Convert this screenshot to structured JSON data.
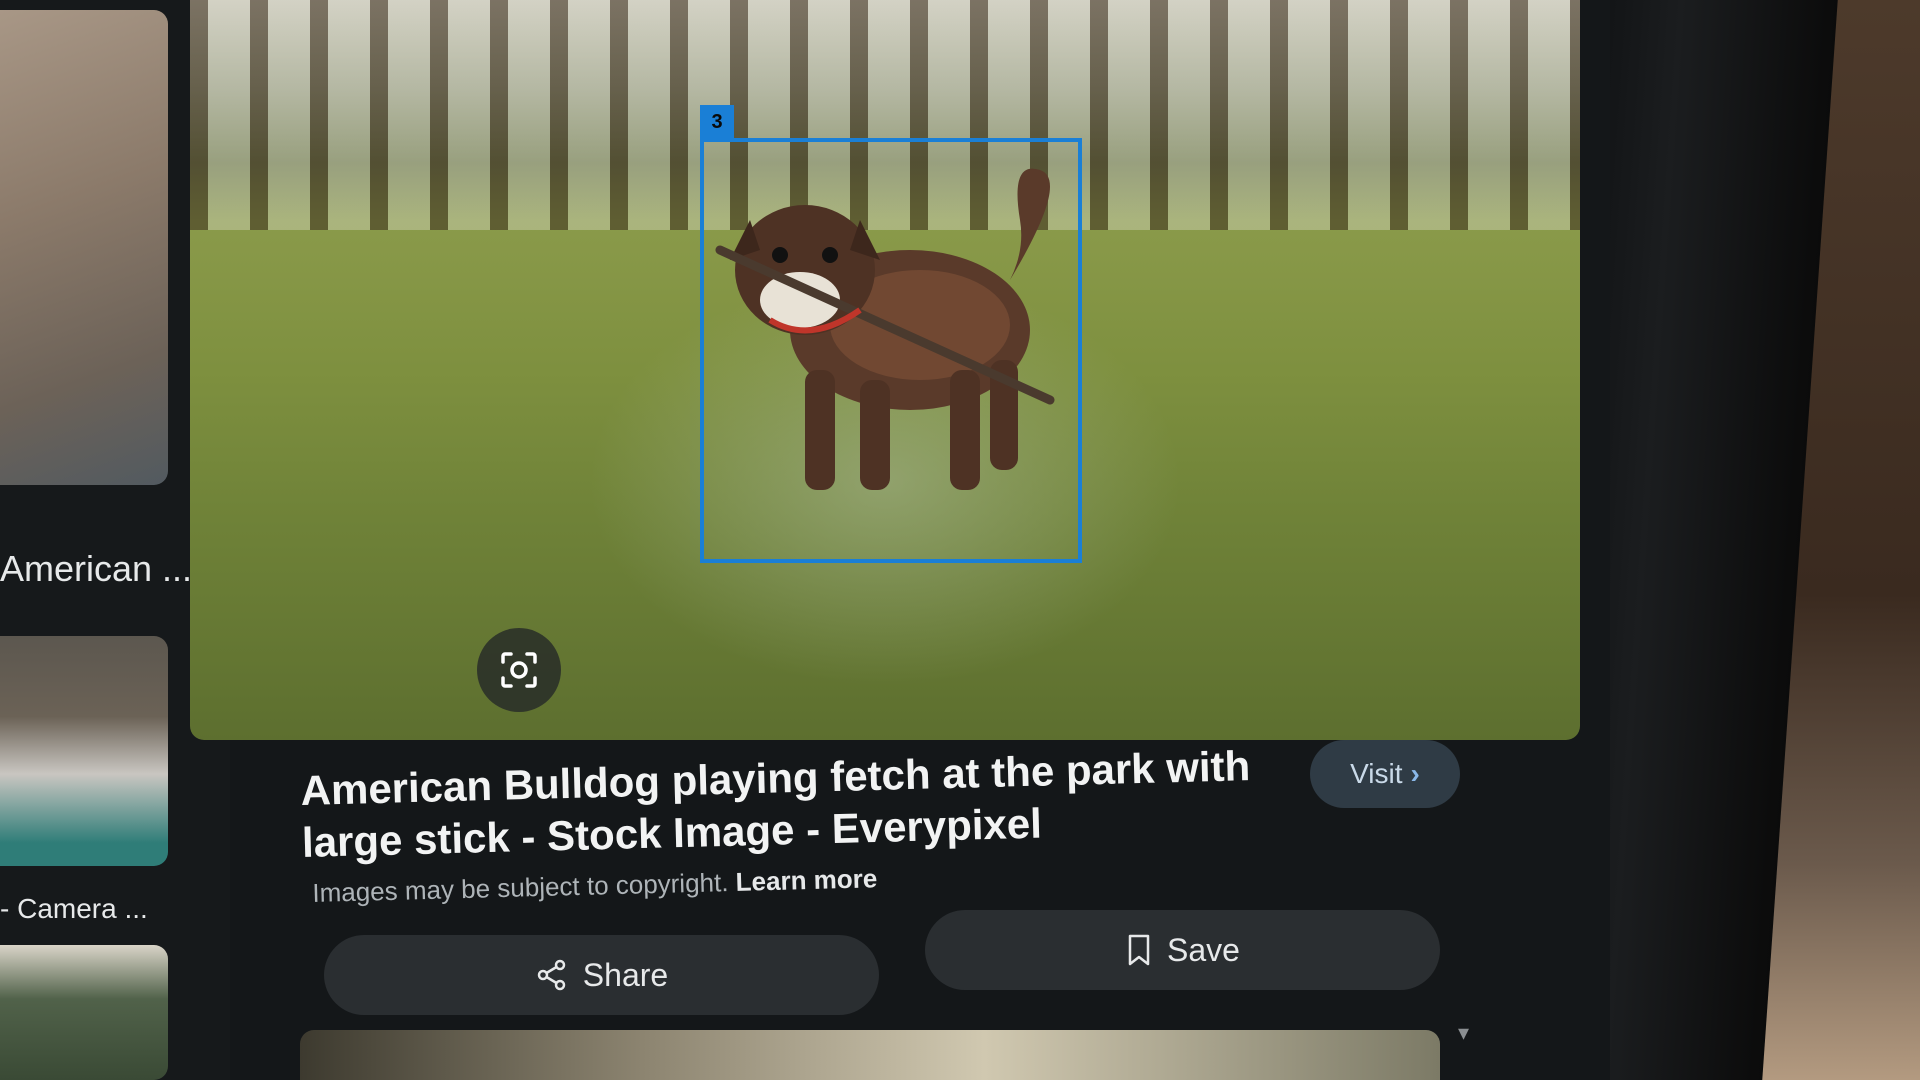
{
  "sidebar": {
    "items": [
      {
        "caption": "American ..."
      },
      {
        "caption": "- Camera ..."
      },
      {
        "caption": ""
      }
    ]
  },
  "viewer": {
    "detection_tag": "3",
    "title": "American Bulldog playing fetch at the park with large stick - Stock Image - Everypixel",
    "copyright_text": "Images may be subject to copyright.",
    "learn_more_label": "Learn more",
    "visit_label": "Visit",
    "share_label": "Share",
    "save_label": "Save"
  },
  "icons": {
    "lens": "google-lens-icon",
    "share": "share-icon",
    "save": "bookmark-icon",
    "visit": "chevron-right-icon"
  },
  "colors": {
    "detection_box": "#1a7fd6",
    "visit_button_bg": "#2f3b45",
    "panel_bg": "#141719"
  }
}
